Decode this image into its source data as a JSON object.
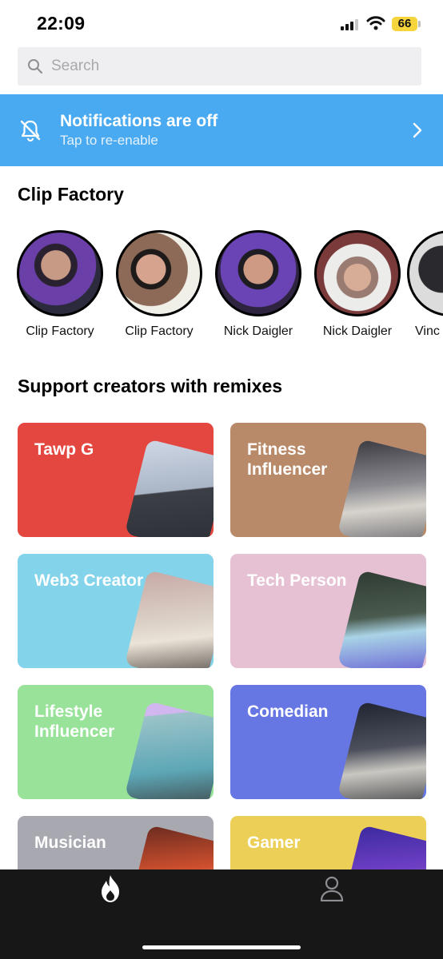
{
  "status_bar": {
    "time": "22:09",
    "battery": "66"
  },
  "search": {
    "placeholder": "Search"
  },
  "notification": {
    "title": "Notifications are off",
    "subtitle": "Tap to re-enable"
  },
  "clip_factory": {
    "title": "Clip Factory",
    "items": [
      {
        "label": "Clip Factory"
      },
      {
        "label": "Clip Factory"
      },
      {
        "label": "Nick Daigler"
      },
      {
        "label": "Nick Daigler"
      },
      {
        "label": "Vinc"
      }
    ]
  },
  "remixes": {
    "title": "Support creators with remixes",
    "cards": [
      {
        "label": "Tawp G",
        "color": "#e4473f"
      },
      {
        "label": "Fitness Influencer",
        "color": "#b98a6a"
      },
      {
        "label": "Web3 Creator",
        "color": "#83d3ea"
      },
      {
        "label": "Tech Person",
        "color": "#e6c1d4"
      },
      {
        "label": "Lifestyle Influencer",
        "color": "#98e299"
      },
      {
        "label": "Comedian",
        "color": "#6677e4"
      },
      {
        "label": "Musician",
        "color": "#a8a9b0"
      },
      {
        "label": "Gamer",
        "color": "#eccf56"
      }
    ]
  },
  "tab_bar": {
    "tabs": [
      {
        "icon": "flame-icon"
      },
      {
        "icon": "profile-icon"
      }
    ]
  }
}
